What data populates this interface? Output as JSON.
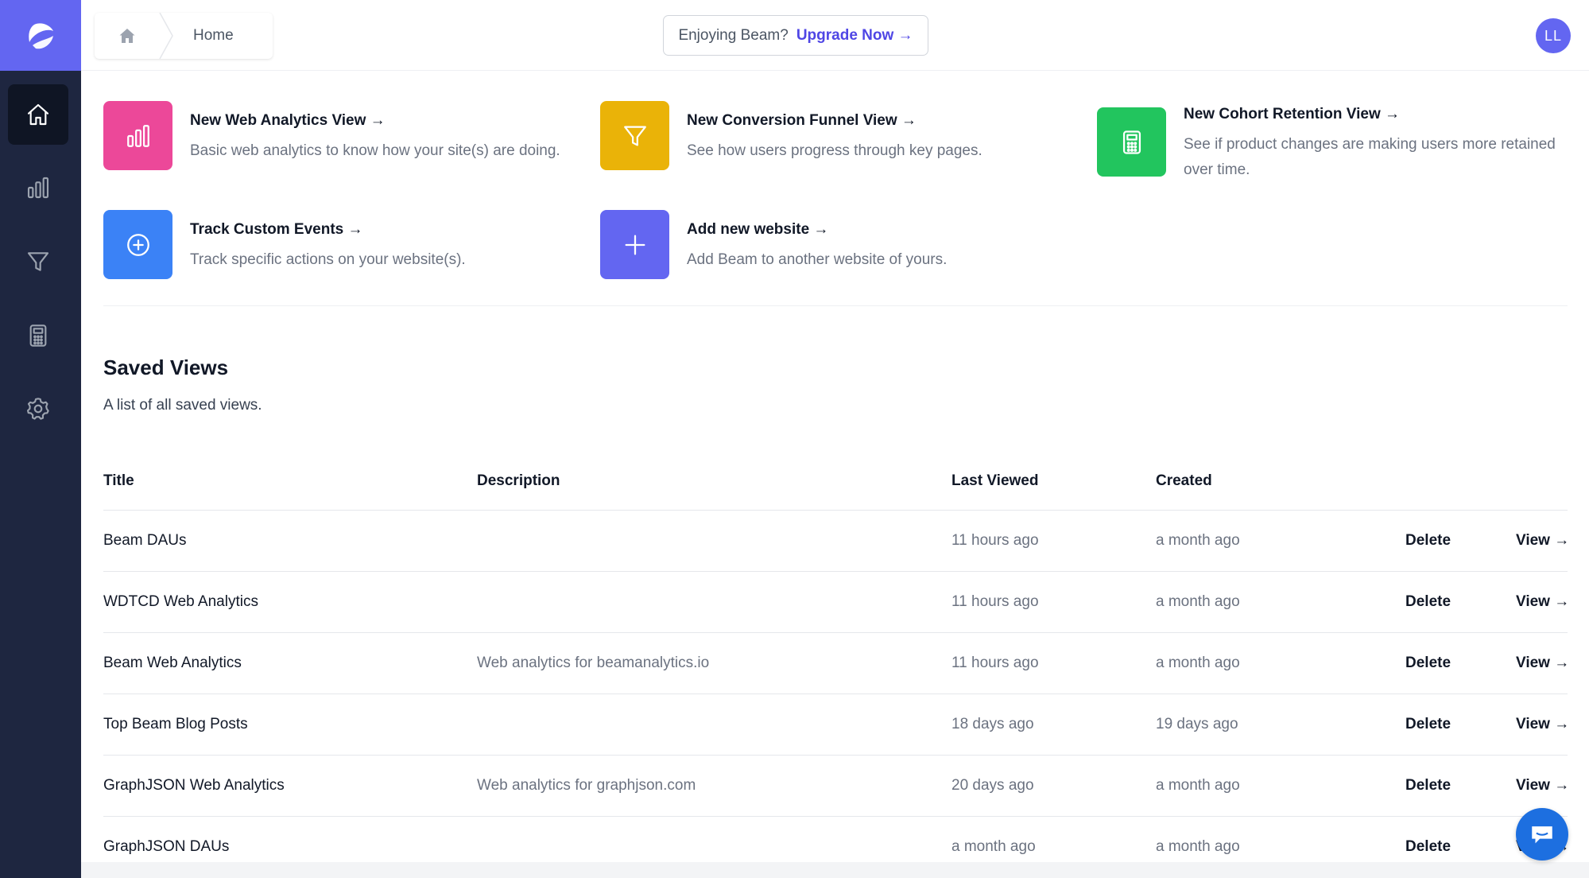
{
  "header": {
    "breadcrumb_label": "Home",
    "upgrade_prompt": "Enjoying Beam?",
    "upgrade_link": "Upgrade Now →",
    "avatar_initials": "LL"
  },
  "sidebar": {
    "items": [
      {
        "icon": "home-icon",
        "active": true
      },
      {
        "icon": "bar-chart-icon",
        "active": false
      },
      {
        "icon": "funnel-icon",
        "active": false
      },
      {
        "icon": "calculator-icon",
        "active": false
      },
      {
        "icon": "gear-icon",
        "active": false
      }
    ]
  },
  "actions": [
    {
      "title": "New Web Analytics View →",
      "desc": "Basic web analytics to know how your site(s) are doing.",
      "icon": "bar-chart-icon",
      "color": "#ec4899"
    },
    {
      "title": "New Conversion Funnel View →",
      "desc": "See how users progress through key pages.",
      "icon": "funnel-icon",
      "color": "#eab308"
    },
    {
      "title": "New Cohort Retention View →",
      "desc_line1": "See if product changes are making users more retained",
      "desc_line2": "over time.",
      "icon": "calculator-icon",
      "color": "#22c55e"
    },
    {
      "title": "Track Custom Events →",
      "desc": "Track specific actions on your website(s).",
      "icon": "plus-circle-icon",
      "color": "#3b82f6"
    },
    {
      "title": "Add new website →",
      "desc": "Add Beam to another website of yours.",
      "icon": "plus-icon",
      "color": "#6366f1"
    }
  ],
  "saved_views": {
    "title": "Saved Views",
    "subtitle": "A list of all saved views.",
    "columns": {
      "title": "Title",
      "description": "Description",
      "last_viewed": "Last Viewed",
      "created": "Created"
    },
    "delete_label": "Delete",
    "view_label": "View →",
    "rows": [
      {
        "title": "Beam DAUs",
        "description": "",
        "last_viewed": "11 hours ago",
        "created": "a month ago"
      },
      {
        "title": "WDTCD Web Analytics",
        "description": "",
        "last_viewed": "11 hours ago",
        "created": "a month ago"
      },
      {
        "title": "Beam Web Analytics",
        "description": "Web analytics for beamanalytics.io",
        "last_viewed": "11 hours ago",
        "created": "a month ago"
      },
      {
        "title": "Top Beam Blog Posts",
        "description": "",
        "last_viewed": "18 days ago",
        "created": "19 days ago"
      },
      {
        "title": "GraphJSON Web Analytics",
        "description": "Web analytics for graphjson.com",
        "last_viewed": "20 days ago",
        "created": "a month ago"
      },
      {
        "title": "GraphJSON DAUs",
        "description": "",
        "last_viewed": "a month ago",
        "created": "a month ago"
      }
    ]
  },
  "colors": {
    "sidebar_bg": "#1e2640",
    "brand": "#6366f1",
    "chat_button": "#1d6fe0"
  }
}
